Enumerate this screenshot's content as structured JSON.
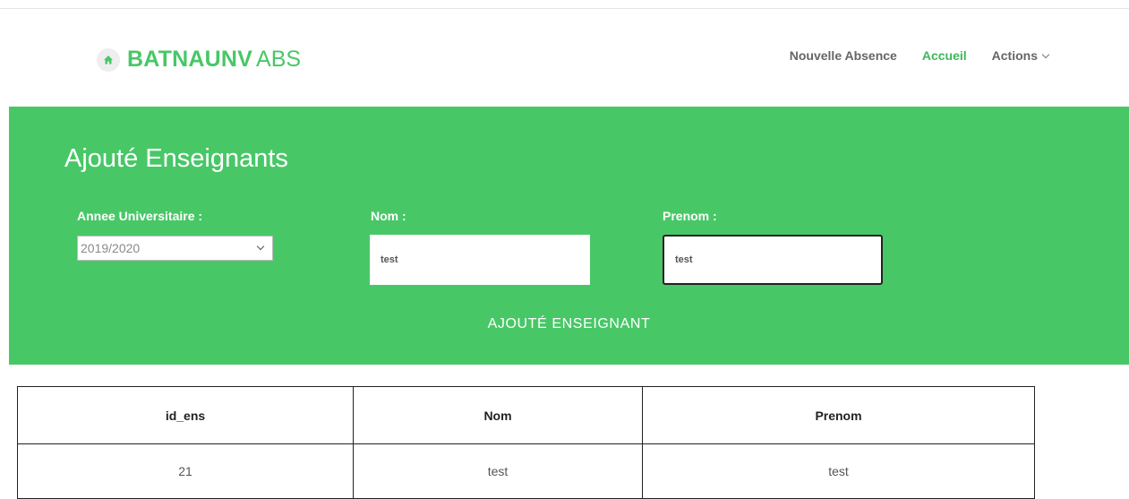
{
  "brand": {
    "bold": "BATNAUNV",
    "light": "ABS",
    "icon": "home-icon",
    "color": "#48c767"
  },
  "nav": {
    "items": [
      {
        "label": "Nouvelle Absence",
        "active": false
      },
      {
        "label": "Accueil",
        "active": true
      },
      {
        "label": "Actions",
        "dropdown": true
      }
    ]
  },
  "form": {
    "title": "Ajouté Enseignants",
    "annee_label": "Annee Universitaire :",
    "annee_value": "2019/2020",
    "nom_label": "Nom :",
    "nom_value": "test",
    "prenom_label": "Prenom :",
    "prenom_value": "test",
    "submit_label": "AJOUTÉ ENSEIGNANT"
  },
  "table": {
    "headers": [
      "id_ens",
      "Nom",
      "Prenom"
    ],
    "rows": [
      [
        "21",
        "test",
        "test"
      ]
    ]
  }
}
